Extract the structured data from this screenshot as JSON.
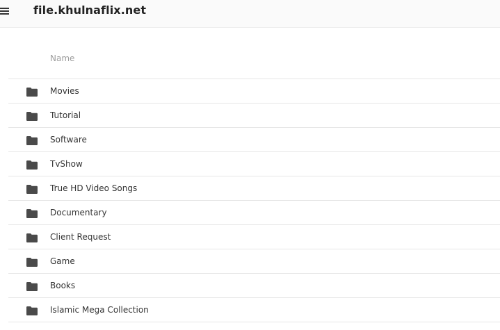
{
  "header": {
    "site_title": "file.khulnaflix.net",
    "menu_icon": "hamburger-menu-icon"
  },
  "listing": {
    "column_name": "Name",
    "folder_icon": "folder-icon",
    "items": [
      {
        "label": "Movies"
      },
      {
        "label": "Tutorial"
      },
      {
        "label": "Software"
      },
      {
        "label": "TvShow"
      },
      {
        "label": "True HD Video Songs"
      },
      {
        "label": "Documentary"
      },
      {
        "label": "Client Request"
      },
      {
        "label": "Game"
      },
      {
        "label": "Books"
      },
      {
        "label": "Islamic Mega Collection"
      }
    ]
  }
}
